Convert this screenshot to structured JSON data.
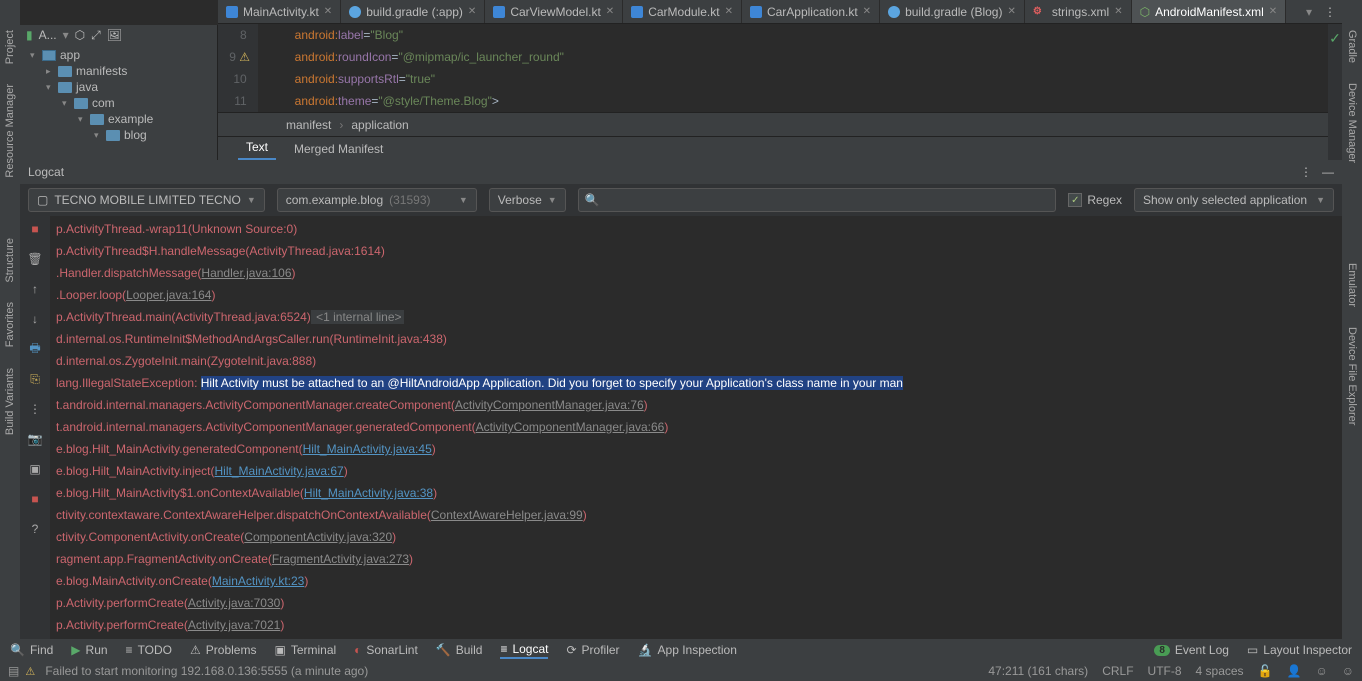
{
  "topLeft": {
    "android": "A...",
    "target": "⬡",
    "expand": "⤢",
    "pin": "↘"
  },
  "tabs": [
    {
      "icon": "kt",
      "label": "MainActivity.kt",
      "close": true
    },
    {
      "icon": "gradle",
      "label": "build.gradle (:app)",
      "close": true
    },
    {
      "icon": "kt",
      "label": "CarViewModel.kt",
      "close": true
    },
    {
      "icon": "kt",
      "label": "CarModule.kt",
      "close": true
    },
    {
      "icon": "kt",
      "label": "CarApplication.kt",
      "close": true
    },
    {
      "icon": "gradle",
      "label": "build.gradle (Blog)",
      "close": true
    },
    {
      "icon": "xml",
      "label": "strings.xml",
      "close": true
    },
    {
      "icon": "manifest",
      "label": "AndroidManifest.xml",
      "close": true,
      "active": true
    }
  ],
  "sideLeft": [
    "Project",
    "Resource Manager",
    "Structure",
    "Favorites",
    "Build Variants"
  ],
  "sideRight": [
    "Gradle",
    "Device Manager",
    "Emulator",
    "Device File Explorer"
  ],
  "projectHead": {
    "title": "app"
  },
  "tree": [
    {
      "d": 0,
      "chev": "▾",
      "ico": "module",
      "label": "app"
    },
    {
      "d": 1,
      "chev": "▸",
      "ico": "folder",
      "label": "manifests"
    },
    {
      "d": 1,
      "chev": "▾",
      "ico": "folder",
      "label": "java"
    },
    {
      "d": 2,
      "chev": "▾",
      "ico": "folder",
      "label": "com"
    },
    {
      "d": 3,
      "chev": "▾",
      "ico": "folder",
      "label": "example"
    },
    {
      "d": 4,
      "chev": "▾",
      "ico": "folder",
      "label": "blog"
    }
  ],
  "gutterLines": [
    "8",
    "9",
    "10",
    "11"
  ],
  "codeLines": [
    {
      "indent": "        ",
      "ns": "android:",
      "key": "label",
      "val": "\"Blog\""
    },
    {
      "indent": "        ",
      "ns": "android:",
      "key": "roundIcon",
      "val": "\"@mipmap/ic_launcher_round\""
    },
    {
      "indent": "        ",
      "ns": "android:",
      "key": "supportsRtl",
      "val": "\"true\""
    },
    {
      "indent": "        ",
      "ns": "android:",
      "key": "theme",
      "val": "\"@style/Theme.Blog\"",
      "tail": ">"
    }
  ],
  "breadcrumb": [
    "manifest",
    "application"
  ],
  "subTabs": [
    {
      "label": "Text",
      "active": true
    },
    {
      "label": "Merged Manifest"
    }
  ],
  "logcat": {
    "title": "Logcat",
    "device": "TECNO MOBILE LIMITED TECNO",
    "process": "com.example.blog",
    "pid": "(31593)",
    "level": "Verbose",
    "searchPlaceholder": "",
    "regexLabel": "Regex",
    "filter": "Show only selected application"
  },
  "logLines": [
    {
      "t": "err",
      "text": "p.ActivityThread.-wrap11(Unknown Source:0)"
    },
    {
      "t": "err",
      "text": "p.ActivityThread$H.handleMessage(ActivityThread.java:1614)"
    },
    {
      "t": "err",
      "pre": ".Handler.dispatchMessage(",
      "lnk": "Handler.java:106",
      "post": ")"
    },
    {
      "t": "err",
      "pre": ".Looper.loop(",
      "lnk": "Looper.java:164",
      "post": ")"
    },
    {
      "t": "err",
      "text": "p.ActivityThread.main(ActivityThread.java:6524)",
      "dim": " <1 internal line>"
    },
    {
      "t": "err",
      "text": "d.internal.os.RuntimeInit$MethodAndArgsCaller.run(RuntimeInit.java:438)"
    },
    {
      "t": "err",
      "text": "d.internal.os.ZygoteInit.main(ZygoteInit.java:888)"
    },
    {
      "t": "err",
      "pre": "lang.IllegalStateException: ",
      "hl": "Hilt Activity must be attached to an @HiltAndroidApp Application. Did you forget to specify your Application's class name in your man"
    },
    {
      "t": "err",
      "pre": "t.android.internal.managers.ActivityComponentManager.createComponent(",
      "lnk": "ActivityComponentManager.java:76",
      "post": ")"
    },
    {
      "t": "err",
      "pre": "t.android.internal.managers.ActivityComponentManager.generatedComponent(",
      "lnk": "ActivityComponentManager.java:66",
      "post": ")"
    },
    {
      "t": "err",
      "pre": "e.blog.Hilt_MainActivity.generatedComponent(",
      "lnkb": "Hilt_MainActivity.java:45",
      "post": ")"
    },
    {
      "t": "err",
      "pre": "e.blog.Hilt_MainActivity.inject(",
      "lnkb": "Hilt_MainActivity.java:67",
      "post": ")"
    },
    {
      "t": "err",
      "pre": "e.blog.Hilt_MainActivity$1.onContextAvailable(",
      "lnkb": "Hilt_MainActivity.java:38",
      "post": ")"
    },
    {
      "t": "err",
      "pre": "ctivity.contextaware.ContextAwareHelper.dispatchOnContextAvailable(",
      "lnk": "ContextAwareHelper.java:99",
      "post": ")"
    },
    {
      "t": "err",
      "pre": "ctivity.ComponentActivity.onCreate(",
      "lnk": "ComponentActivity.java:320",
      "post": ")"
    },
    {
      "t": "err",
      "pre": "ragment.app.FragmentActivity.onCreate(",
      "lnk": "FragmentActivity.java:273",
      "post": ")"
    },
    {
      "t": "err",
      "pre": "e.blog.MainActivity.onCreate(",
      "lnkb": "MainActivity.kt:23",
      "post": ")"
    },
    {
      "t": "err",
      "pre": "p.Activity.performCreate(",
      "lnk": "Activity.java:7030",
      "post": ")"
    },
    {
      "t": "err",
      "pre": "p.Activity.performCreate(",
      "lnk": "Activity.java:7021",
      "post": ")"
    }
  ],
  "bottomTools": [
    {
      "ico": "🔍",
      "label": "Find"
    },
    {
      "ico": "▶",
      "label": "Run",
      "cls": "green-run"
    },
    {
      "ico": "≡",
      "label": "TODO"
    },
    {
      "ico": "⚠",
      "label": "Problems"
    },
    {
      "ico": "▣",
      "label": "Terminal"
    },
    {
      "ico": "◐",
      "label": "SonarLint",
      "cls": "red-stop"
    },
    {
      "ico": "🔨",
      "label": "Build"
    },
    {
      "ico": "≡",
      "label": "Logcat",
      "active": true
    },
    {
      "ico": "⟳",
      "label": "Profiler"
    },
    {
      "ico": "🔬",
      "label": "App Inspection"
    }
  ],
  "bottomRight": [
    {
      "badge": "8",
      "label": "Event Log"
    },
    {
      "ico": "▭",
      "label": "Layout Inspector"
    }
  ],
  "status": {
    "msg": "Failed to start monitoring 192.168.0.136:5555 (a minute ago)",
    "pos": "47:211 (161 chars)",
    "le": "CRLF",
    "enc": "UTF-8",
    "indent": "4 spaces"
  }
}
